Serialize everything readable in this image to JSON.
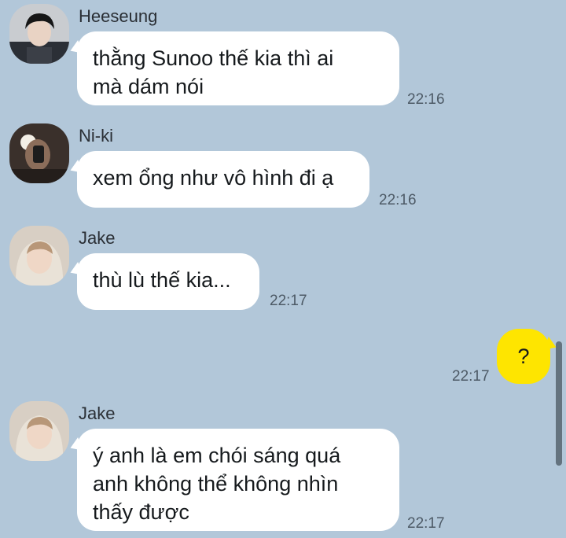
{
  "messages": [
    {
      "sender": "Heeseung",
      "avatar": "heeseung-avatar",
      "lines": [
        "thằng Sunoo thế kia thì ai",
        "mà dám nói"
      ],
      "time": "22:16"
    },
    {
      "sender": "Ni-ki",
      "avatar": "niki-avatar",
      "lines": [
        "xem ổng như vô hình đi ạ"
      ],
      "time": "22:16"
    },
    {
      "sender": "Jake",
      "avatar": "jake-avatar",
      "lines": [
        "thù lù thế kia..."
      ],
      "time": "22:17"
    },
    {
      "sender": "",
      "lines": [
        "?"
      ],
      "time": "22:17"
    },
    {
      "sender": "Jake",
      "avatar": "jake-avatar",
      "lines": [
        "ý anh là em chói sáng quá",
        "anh không thể không nhìn",
        "thấy được"
      ],
      "time": "22:17"
    }
  ],
  "colors": {
    "background": "#b2c7d9",
    "incoming_bubble": "#ffffff",
    "outgoing_bubble": "#fee500",
    "timestamp": "#4d5a66"
  }
}
